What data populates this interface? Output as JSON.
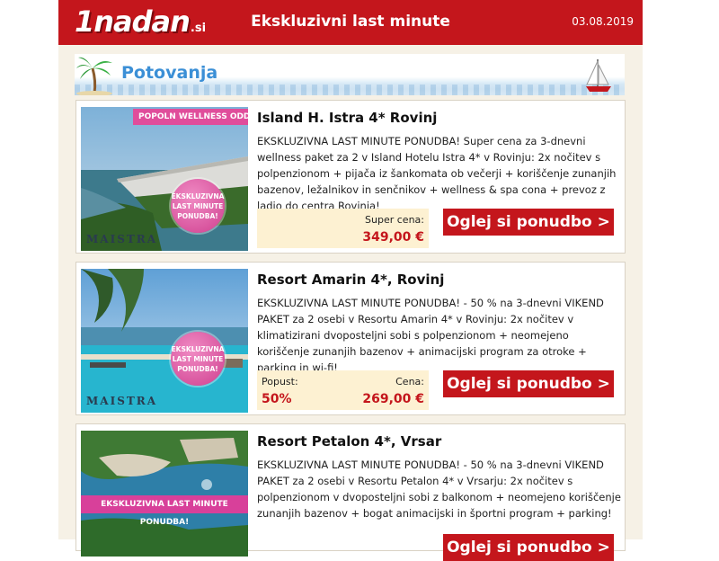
{
  "header": {
    "logo_text": "1nadan",
    "logo_tld": ".si",
    "title": "Ekskluzivni last minute",
    "date": "03.08.2019"
  },
  "category": {
    "title": "Potovanja"
  },
  "offers": [
    {
      "title": "Island H. Istra 4* Rovinj",
      "description": "EKSKLUZIVNA LAST MINUTE PONUDBA! Super cena za 3-dnevni wellness paket za 2 v Island Hotelu Istra 4* v Rovinju: 2x nočitev s polpenzionom + pijača iz šankomata ob večerji + koriščenje zunanjih bazenov, ležalnikov in senčnikov + wellness & spa cona + prevoz z ladjo do centra Rovinja!",
      "price_label": "Super cena:",
      "price": "349,00 €",
      "button": "Oglej si ponudbo >",
      "image_tag": "POPOLN WELLNESS ODDIH",
      "image_badge": "EKSKLUZIVNA LAST MINUTE PONUDBA!",
      "image_brand": "MAISTRA"
    },
    {
      "title": "Resort Amarin 4*, Rovinj",
      "description": "EKSKLUZIVNA LAST MINUTE PONUDBA! - 50 % na 3-dnevni VIKEND PAKET za 2 osebi v Resortu Amarin 4* v Rovinju: 2x nočitev v klimatizirani dvoposteljni sobi s polpenzionom + neomejeno koriščenje zunanjih bazenov + animacijski program za otroke + parking in wi-fi!",
      "discount_label": "Popust:",
      "discount": "50%",
      "price_label": "Cena:",
      "price": "269,00 €",
      "button": "Oglej si ponudbo >",
      "image_badge": "EKSKLUZIVNA LAST MINUTE PONUDBA!",
      "image_brand": "MAISTRA"
    },
    {
      "title": "Resort Petalon 4*, Vrsar",
      "description": "EKSKLUZIVNA LAST MINUTE PONUDBA! - 50 % na 3-dnevni VIKEND PAKET za 2 osebi v Resortu Petalon 4* v Vrsarju: 2x nočitev s polpenzionom v dvoposteljni sobi z balkonom + neomejeno koriščenje zunanjih bazenov + bogat animacijski in športni program + parking!",
      "button": "Oglej si ponudbo >",
      "image_strip": "EKSKLUZIVNA LAST MINUTE PONUDBA!"
    }
  ],
  "colors": {
    "brand_red": "#c4161c",
    "category_blue": "#3b8fd6",
    "price_box": "#fdf1d2",
    "badge_pink": "#e04d9b"
  }
}
